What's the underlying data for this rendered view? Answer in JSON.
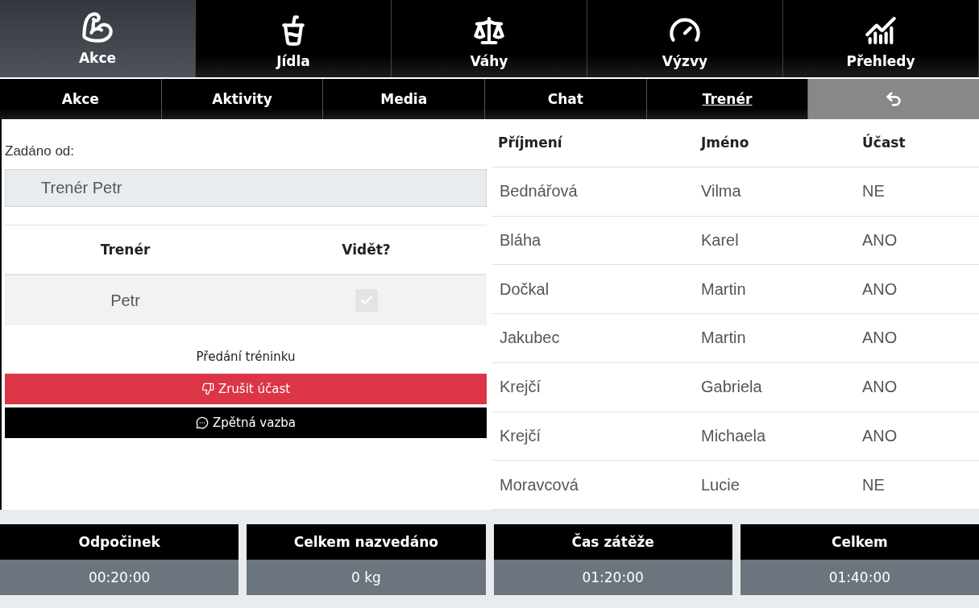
{
  "main_nav": [
    {
      "label": "Akce",
      "selected": true
    },
    {
      "label": "Jídla",
      "selected": false
    },
    {
      "label": "Váhy",
      "selected": false
    },
    {
      "label": "Výzvy",
      "selected": false
    },
    {
      "label": "Přehledy",
      "selected": false
    }
  ],
  "sub_nav": [
    {
      "label": "Akce",
      "selected": false
    },
    {
      "label": "Aktivity",
      "selected": false
    },
    {
      "label": "Media",
      "selected": false
    },
    {
      "label": "Chat",
      "selected": false
    },
    {
      "label": "Trenér",
      "selected": true
    }
  ],
  "assigned": {
    "label": "Zadáno od:",
    "value": "Trenér Petr"
  },
  "trainer_table": {
    "columns": [
      "Trenér",
      "Vidět?"
    ],
    "rows": [
      {
        "name": "Petr",
        "visible": true,
        "disabled": true
      }
    ]
  },
  "handover_label": "Předání tréninku",
  "buttons": [
    {
      "kind": "danger",
      "label": "Zrušit účast"
    },
    {
      "kind": "dark",
      "label": "Zpětná vazba"
    }
  ],
  "participants": {
    "columns": [
      "Příjmení",
      "Jméno",
      "Účast"
    ],
    "rows": [
      [
        "Bednářová",
        "Vilma",
        "NE"
      ],
      [
        "Bláha",
        "Karel",
        "ANO"
      ],
      [
        "Dočkal",
        "Martin",
        "ANO"
      ],
      [
        "Jakubec",
        "Martin",
        "ANO"
      ],
      [
        "Krejčí",
        "Gabriela",
        "ANO"
      ],
      [
        "Krejčí",
        "Michaela",
        "ANO"
      ],
      [
        "Moravcová",
        "Lucie",
        "NE"
      ]
    ]
  },
  "stats": [
    {
      "label": "Odpočinek",
      "value": "00:20:00"
    },
    {
      "label": "Celkem nazvedáno",
      "value": "0 kg"
    },
    {
      "label": "Čas zátěže",
      "value": "01:20:00"
    },
    {
      "label": "Celkem",
      "value": "01:40:00"
    }
  ]
}
